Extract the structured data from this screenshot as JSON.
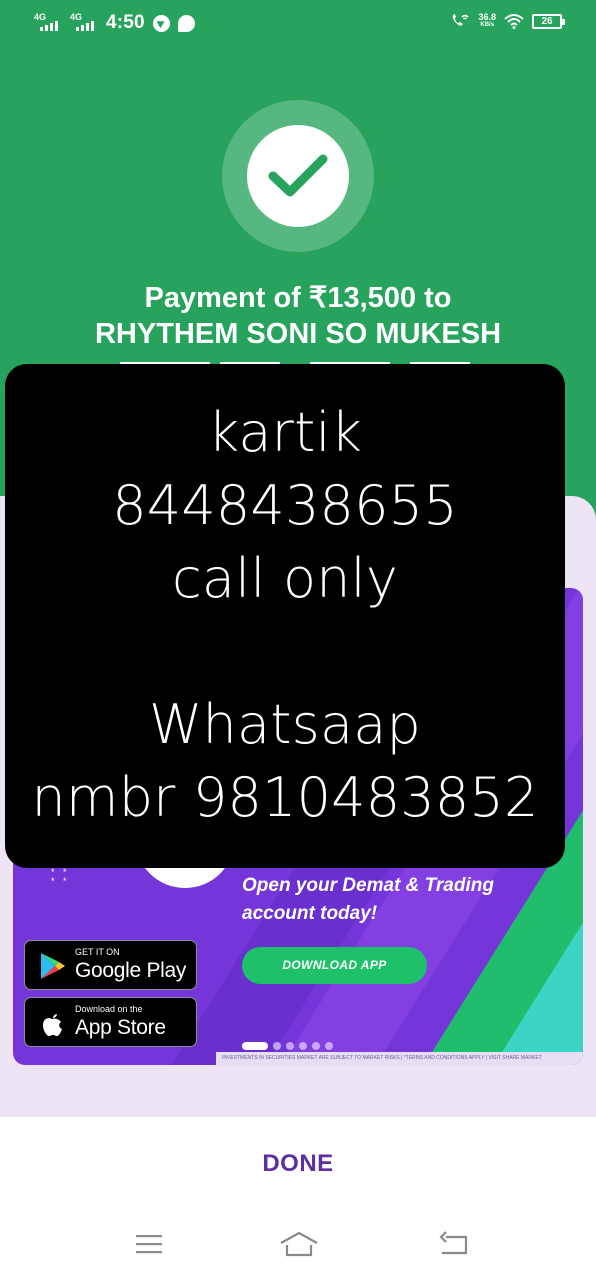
{
  "status_bar": {
    "network_1": "4G",
    "network_2": "4G",
    "time": "4:50",
    "speed_value": "36.8",
    "speed_unit": "KB/s",
    "battery_level": "26"
  },
  "payment": {
    "line1": "Payment of ₹13,500 to",
    "line2": "RHYTHEM SONI SO MUKESH",
    "status_icon": "check-icon"
  },
  "overlay": {
    "lines": [
      "kartik",
      "8448438655",
      "call only",
      "",
      "Whatsaap",
      "nmbr 9810483852"
    ]
  },
  "banner": {
    "promo_line1": "Open your Demat & Trading",
    "promo_line2": "account today!",
    "cta_label": "DOWNLOAD APP",
    "google_play_small": "GET IT ON",
    "google_play_big": "Google Play",
    "app_store_small": "Download on the",
    "app_store_big": "App Store",
    "disclaimer": "INVESTMENTS IN SECURITIES MARKET ARE SUBJECT TO MARKET RISKS  |  *TERMS AND CONDITIONS APPLY  |  VISIT SHARE MARKET",
    "carousel_active_index": 0,
    "carousel_count": 6
  },
  "footer": {
    "done_label": "DONE"
  },
  "nav": {
    "menu_icon": "menu-icon",
    "home_icon": "home-icon",
    "back_icon": "back-icon"
  },
  "colors": {
    "success_green": "#27a35d",
    "card_lavender": "#ede5f6",
    "banner_purple": "#7536d9",
    "cta_green": "#1ec06a",
    "done_purple": "#5d2fa2"
  }
}
